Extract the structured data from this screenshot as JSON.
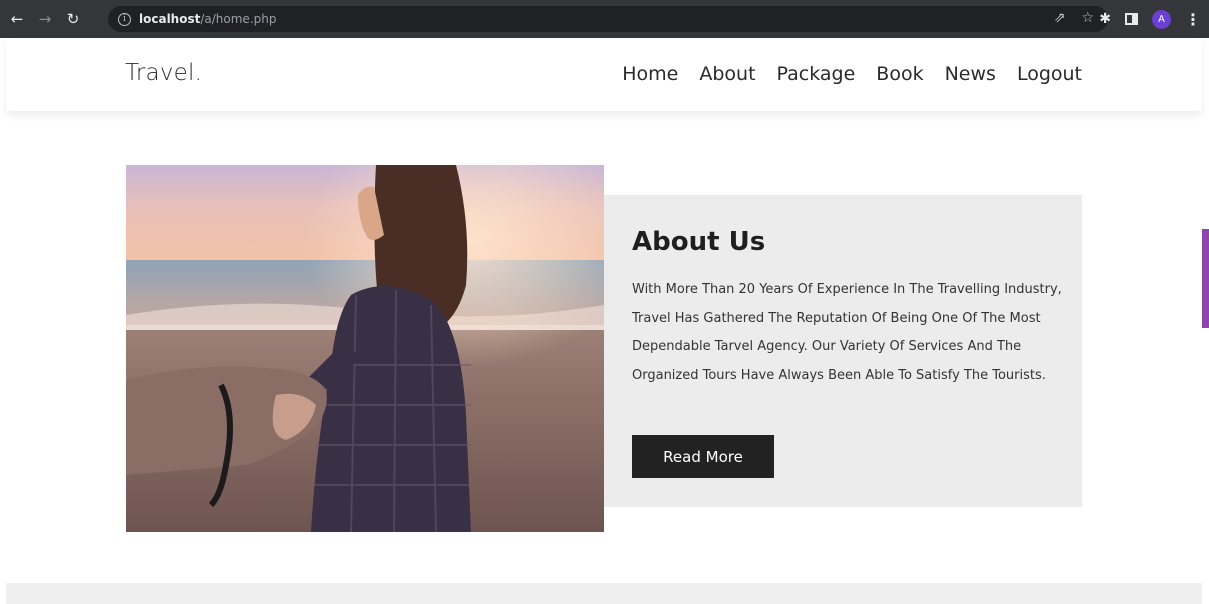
{
  "browser": {
    "url_host": "localhost",
    "url_path": "/a/home.php",
    "profile_initial": "A"
  },
  "header": {
    "logo": "Travel.",
    "nav": [
      "Home",
      "About",
      "Package",
      "Book",
      "News",
      "Logout"
    ]
  },
  "about": {
    "title": "About Us",
    "text": "With More Than 20 Years Of Experience In The Travelling Industry, Travel Has Gathered The Reputation Of Being One Of The Most Dependable Tarvel Agency. Our Variety Of Services And The Organized Tours Have Always Been Able To Satisfy The Tourists.",
    "button": "Read More"
  },
  "colors": {
    "chrome_bg": "#35363a",
    "box_bg": "#ececec",
    "button_bg": "#222222",
    "side_tab": "#8e44ad"
  }
}
